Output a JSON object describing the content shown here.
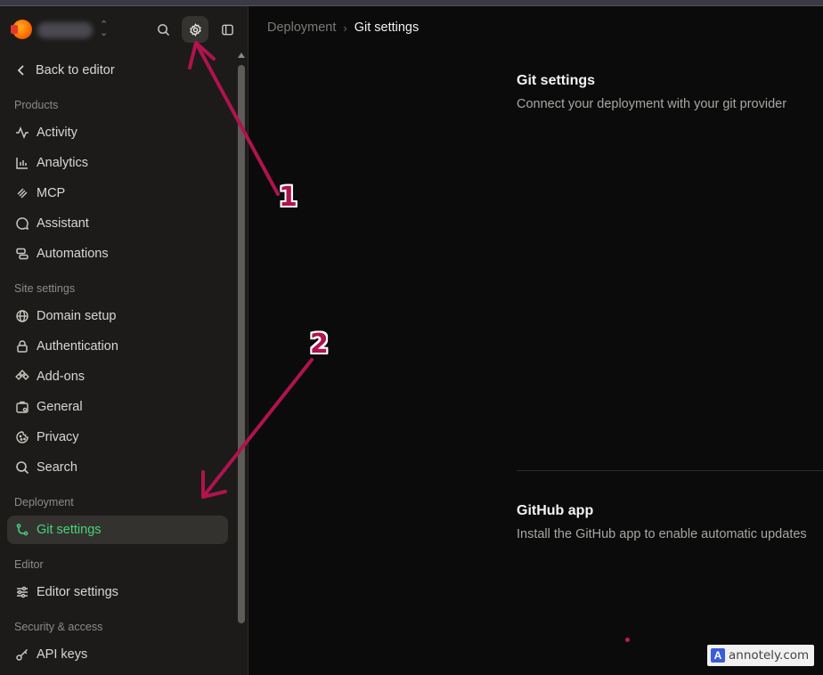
{
  "colors": {
    "accent": "#46d47a",
    "annotation": "#b0134e",
    "sidebar_bg": "#1c1b1a",
    "main_bg": "#0b0b0b"
  },
  "header": {
    "search_icon": "search-icon",
    "settings_icon": "gear-icon",
    "panel_icon": "sidebar-toggle-icon"
  },
  "sidebar": {
    "back_label": "Back to editor",
    "sections": [
      {
        "label": "Products",
        "items": [
          {
            "label": "Activity",
            "icon": "activity-icon"
          },
          {
            "label": "Analytics",
            "icon": "bar-chart-icon"
          },
          {
            "label": "MCP",
            "icon": "mcp-icon"
          },
          {
            "label": "Assistant",
            "icon": "assistant-icon"
          },
          {
            "label": "Automations",
            "icon": "automations-icon"
          }
        ]
      },
      {
        "label": "Site settings",
        "items": [
          {
            "label": "Domain setup",
            "icon": "globe-icon"
          },
          {
            "label": "Authentication",
            "icon": "lock-icon"
          },
          {
            "label": "Add-ons",
            "icon": "add-ons-icon"
          },
          {
            "label": "General",
            "icon": "general-icon"
          },
          {
            "label": "Privacy",
            "icon": "cookie-icon"
          },
          {
            "label": "Search",
            "icon": "search-icon"
          }
        ]
      },
      {
        "label": "Deployment",
        "items": [
          {
            "label": "Git settings",
            "icon": "git-branch-icon",
            "active": true
          }
        ]
      },
      {
        "label": "Editor",
        "items": [
          {
            "label": "Editor settings",
            "icon": "sliders-icon"
          }
        ]
      },
      {
        "label": "Security & access",
        "items": [
          {
            "label": "API keys",
            "icon": "key-icon"
          }
        ]
      }
    ]
  },
  "main": {
    "breadcrumb": {
      "parent": "Deployment",
      "current": "Git settings"
    },
    "git_settings": {
      "title": "Git settings",
      "description": "Connect your deployment with your git provider"
    },
    "github_app": {
      "title": "GitHub app",
      "description": "Install the GitHub app to enable automatic updates"
    }
  },
  "annotations": {
    "marker_1": "1",
    "marker_2": "2"
  },
  "watermark": {
    "text": "annotely.com",
    "logo": "A"
  }
}
